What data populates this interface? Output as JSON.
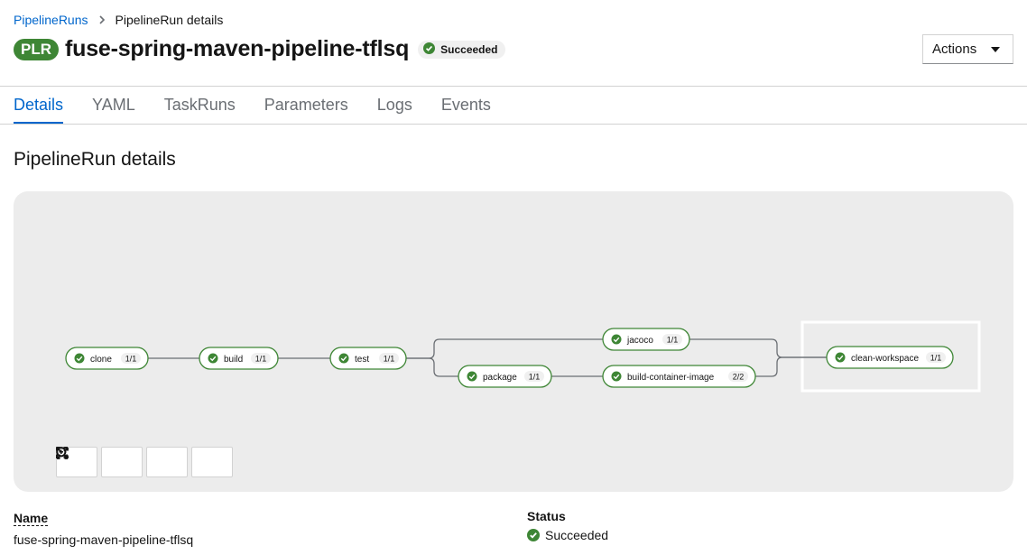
{
  "breadcrumb": {
    "parent": "PipelineRuns",
    "current": "PipelineRun details"
  },
  "header": {
    "badge": "PLR",
    "title": "fuse-spring-maven-pipeline-tflsq",
    "status": "Succeeded",
    "actions_label": "Actions"
  },
  "tabs": [
    {
      "label": "Details",
      "active": true
    },
    {
      "label": "YAML",
      "active": false
    },
    {
      "label": "TaskRuns",
      "active": false
    },
    {
      "label": "Parameters",
      "active": false
    },
    {
      "label": "Logs",
      "active": false
    },
    {
      "label": "Events",
      "active": false
    }
  ],
  "section_title": "PipelineRun details",
  "graph": {
    "nodes": [
      {
        "id": "clone",
        "label": "clone",
        "count": "1/1",
        "status": "succeeded"
      },
      {
        "id": "build",
        "label": "build",
        "count": "1/1",
        "status": "succeeded"
      },
      {
        "id": "test",
        "label": "test",
        "count": "1/1",
        "status": "succeeded"
      },
      {
        "id": "jacoco",
        "label": "jacoco",
        "count": "1/1",
        "status": "succeeded"
      },
      {
        "id": "package",
        "label": "package",
        "count": "1/1",
        "status": "succeeded"
      },
      {
        "id": "build-container-image",
        "label": "build-container-image",
        "count": "2/2",
        "status": "succeeded"
      },
      {
        "id": "clean-workspace",
        "label": "clean-workspace",
        "count": "1/1",
        "status": "succeeded"
      }
    ],
    "edges": [
      [
        "clone",
        "build"
      ],
      [
        "build",
        "test"
      ],
      [
        "test",
        "jacoco"
      ],
      [
        "test",
        "package"
      ],
      [
        "package",
        "build-container-image"
      ],
      [
        "jacoco",
        "clean-workspace"
      ],
      [
        "build-container-image",
        "clean-workspace"
      ]
    ],
    "finally_group": [
      "clean-workspace"
    ],
    "zoom_controls": [
      "zoom-in-icon",
      "zoom-out-icon",
      "fit-to-screen-icon",
      "reset-view-icon"
    ]
  },
  "details": {
    "name_label": "Name",
    "name_value": "fuse-spring-maven-pipeline-tflsq",
    "status_label": "Status",
    "status_value": "Succeeded"
  },
  "colors": {
    "success": "#3e8635",
    "link": "#0066cc",
    "graph_bg": "#ececec"
  }
}
